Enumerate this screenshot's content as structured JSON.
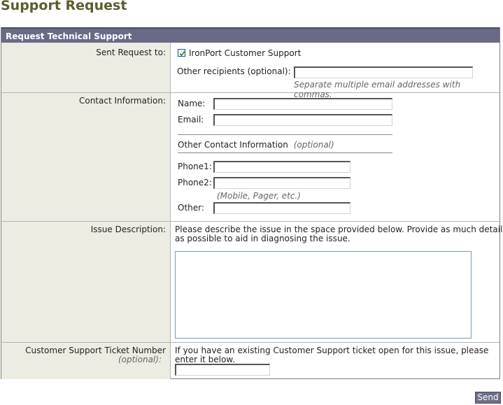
{
  "page": {
    "title": "Support Request"
  },
  "panel": {
    "header": "Request Technical Support"
  },
  "sent_request": {
    "label": "Sent Request to:",
    "checkbox_label": "IronPort Customer Support",
    "checked": true,
    "other_label": "Other recipients (optional):",
    "other_value": "",
    "hint": "Separate multiple email addresses with commas."
  },
  "contact": {
    "label": "Contact Information:",
    "name_label": "Name:",
    "name_value": "",
    "email_label": "Email:",
    "email_value": "",
    "other_heading": "Other Contact Information",
    "other_heading_opt": "(optional)",
    "phone1_label": "Phone1:",
    "phone1_value": "",
    "phone2_label": "Phone2:",
    "phone2_value": "",
    "phone2_hint": "(Mobile, Pager, etc.)",
    "other_label": "Other:",
    "other_value": ""
  },
  "issue": {
    "label": "Issue Description:",
    "instructions_line1": "Please describe the issue in the space provided below. Provide as much detail",
    "instructions_line2": "as possible to aid in diagnosing the issue.",
    "value": ""
  },
  "ticket": {
    "label": "Customer Support Ticket Number",
    "label_opt": "(optional):",
    "instructions_line1": "If you have an existing Customer Support ticket open for this issue, please",
    "instructions_line2": "enter it below.",
    "value": ""
  },
  "actions": {
    "send_label": "Send"
  },
  "colors": {
    "title": "#5c5c2e",
    "header_bg": "#696a86",
    "label_bg": "#ecece3",
    "button_bg": "#6d6f89"
  }
}
